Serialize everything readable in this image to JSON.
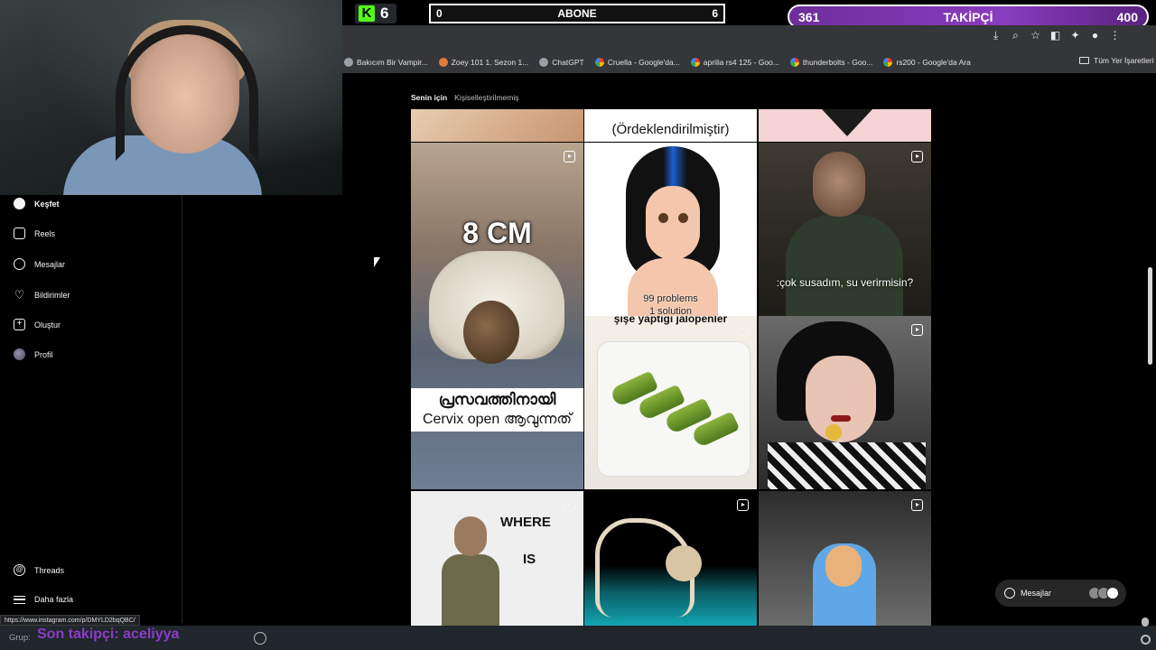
{
  "stream": {
    "kick_number": "6",
    "abone": {
      "current": "0",
      "label": "ABONE",
      "goal": "6"
    },
    "takipci": {
      "current": "361",
      "label": "TAKİPÇİ",
      "goal": "400"
    }
  },
  "bookmarks": [
    {
      "label": "Bakıcım Bir Vampir..."
    },
    {
      "label": "Zoey 101 1. Sezon 1..."
    },
    {
      "label": "ChatGPT"
    },
    {
      "label": "Cruella - Google'da..."
    },
    {
      "label": "aprilia rs4 125 - Goo..."
    },
    {
      "label": "thunderbolts - Goo..."
    },
    {
      "label": "rs200 - Google'da Ara"
    }
  ],
  "all_bookmarks_label": "Tüm Yer İşaretleri",
  "sidebar": {
    "items": [
      {
        "label": "Keşfet",
        "icon": "compass-icon"
      },
      {
        "label": "Reels",
        "icon": "reels-icon"
      },
      {
        "label": "Mesajlar",
        "icon": "messenger-icon"
      },
      {
        "label": "Bildirimler",
        "icon": "heart-icon"
      },
      {
        "label": "Oluştur",
        "icon": "plus-icon"
      },
      {
        "label": "Profil",
        "icon": "avatar-icon"
      }
    ],
    "bottom": [
      {
        "label": "Threads",
        "icon": "threads-icon"
      },
      {
        "label": "Daha fazla",
        "icon": "menu-icon"
      }
    ]
  },
  "feed": {
    "tab_active": "Senin için",
    "tab_other": "Kişiselleştirilmemiş",
    "tiles": {
      "top_mid_text": "(Ördeklendirilmiştir)",
      "anatomy_size": "8 CM",
      "anatomy_caption_1": "പ്രസവത്തിനായി",
      "anatomy_caption_2": "Cervix open ആവുന്നത്",
      "avatar_text_1": "99 problems",
      "avatar_text_2": "1 solution",
      "man_subtitle": ":çok susadım, su verirmisin?",
      "jalapeno_title": "şişe yaptığı jalopeñler",
      "where_1": "WHERE",
      "where_2": "IS"
    }
  },
  "messages_pill_label": "Mesajlar",
  "status_url": "https://www.instagram.com/p/DMYLD2bqQBC/",
  "chat": {
    "grup_label": "Grup:",
    "follower_text": "Son takipçi: aceliyya"
  }
}
